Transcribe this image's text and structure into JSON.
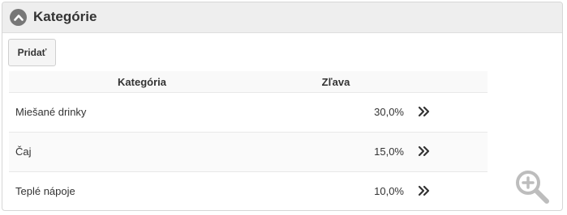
{
  "panel": {
    "title": "Kategórie",
    "collapse_icon": "chevron-up-icon",
    "add_label": "Pridať"
  },
  "table": {
    "headers": {
      "category": "Kategória",
      "discount": "Zľava"
    },
    "rows": [
      {
        "name": "Miešané drinky",
        "discount": "30,0%",
        "action_icon": "double-chevron-right-icon"
      },
      {
        "name": "Čaj",
        "discount": "15,0%",
        "action_icon": "double-chevron-right-icon"
      },
      {
        "name": "Teplé nápoje",
        "discount": "10,0%",
        "action_icon": "double-chevron-right-icon"
      }
    ]
  },
  "overlay": {
    "zoom_icon": "zoom-in-icon"
  },
  "colors": {
    "header_bg": "#eeeeee",
    "icon_gray": "#777777",
    "text": "#333333"
  }
}
